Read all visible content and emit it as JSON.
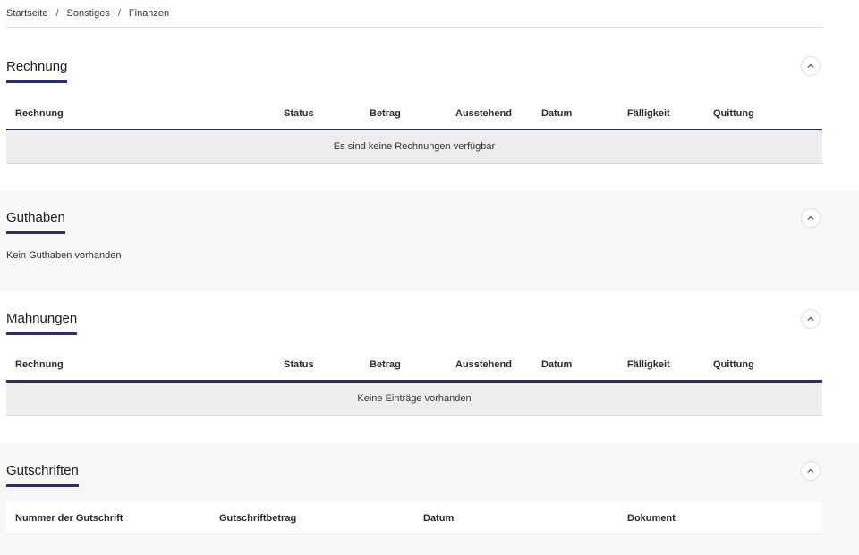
{
  "breadcrumb": {
    "items": [
      "Startseite",
      "Sonstiges",
      "Finanzen"
    ],
    "separator": "/"
  },
  "invoices": {
    "title": "Rechnung",
    "columns": [
      "Rechnung",
      "Status",
      "Betrag",
      "Ausstehend",
      "Datum",
      "Fälligkeit",
      "Quittung"
    ],
    "empty_message": "Es sind keine Rechnungen verfügbar"
  },
  "credit": {
    "title": "Guthaben",
    "empty_message": "Kein Guthaben vorhanden"
  },
  "reminders": {
    "title": "Mahnungen",
    "columns": [
      "Rechnung",
      "Status",
      "Betrag",
      "Ausstehend",
      "Datum",
      "Fälligkeit",
      "Quittung"
    ],
    "empty_message": "Keine Einträge vorhanden"
  },
  "credit_notes": {
    "title": "Gutschriften",
    "columns": [
      "Nummer der Gutschrift",
      "Gutschriftbetrag",
      "Datum",
      "Dokument"
    ]
  },
  "icons": {
    "collapse": "chevron-up-icon"
  },
  "colors": {
    "accent": "#2b2f66",
    "section_grey": "#f7f7f7",
    "empty_row": "#ededed"
  }
}
